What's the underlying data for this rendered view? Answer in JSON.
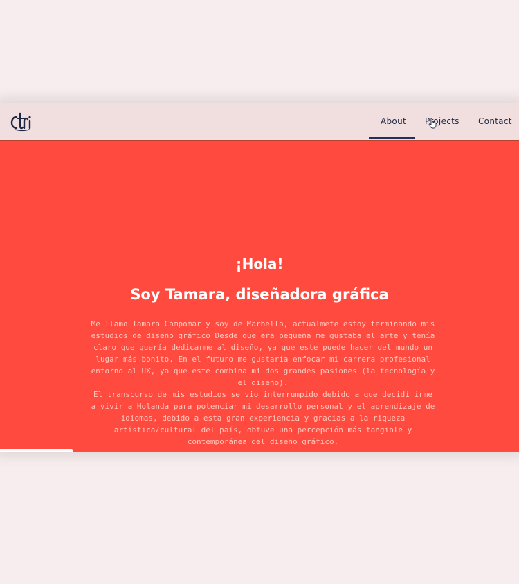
{
  "colors": {
    "page_background": "#f8edee",
    "navbar_background": "#f1dfe0",
    "hero_background": "#ff4b3f",
    "nav_text": "#1e2a44",
    "nav_underline": "#22305a",
    "hero_heading": "#ffffff",
    "hero_body_text": "#ffc7bd"
  },
  "navbar": {
    "logo_icon": "ctri-logo-icon",
    "items": [
      {
        "label": "About",
        "active": true
      },
      {
        "label": "Projects",
        "active": false
      },
      {
        "label": "Contact",
        "active": false
      }
    ]
  },
  "hero": {
    "greeting": "¡Hola!",
    "title": "Soy Tamara, diseñadora gráfica",
    "paragraphs": [
      "Me llamo Tamara Campomar y soy de Marbella, actualmete estoy terminando mis estudios de diseño gráfico Desde que era pequeña me gustaba el arte y tenía claro que quería dedicarme al diseño, ya que este puede hacer del mundo un lugar más bonito. En el futuro me gustaría enfocar mi carrera profesional entorno al UX, ya que este combina mi dos grandes pasiones (la tecnología y el diseño).",
      "El transcurso de mis estudios se vio interrumpido debido a que decidí irme a vivir a Holanda para potenciar mi desarrollo personal y el aprendizaje de idiomas, debido a esta gran experiencia y gracias a la riqueza artística/cultural del país, obtuve una percepción más tangible y contemporánea del diseño gráfico."
    ]
  },
  "cursor_icon": "hand-pointer-icon"
}
